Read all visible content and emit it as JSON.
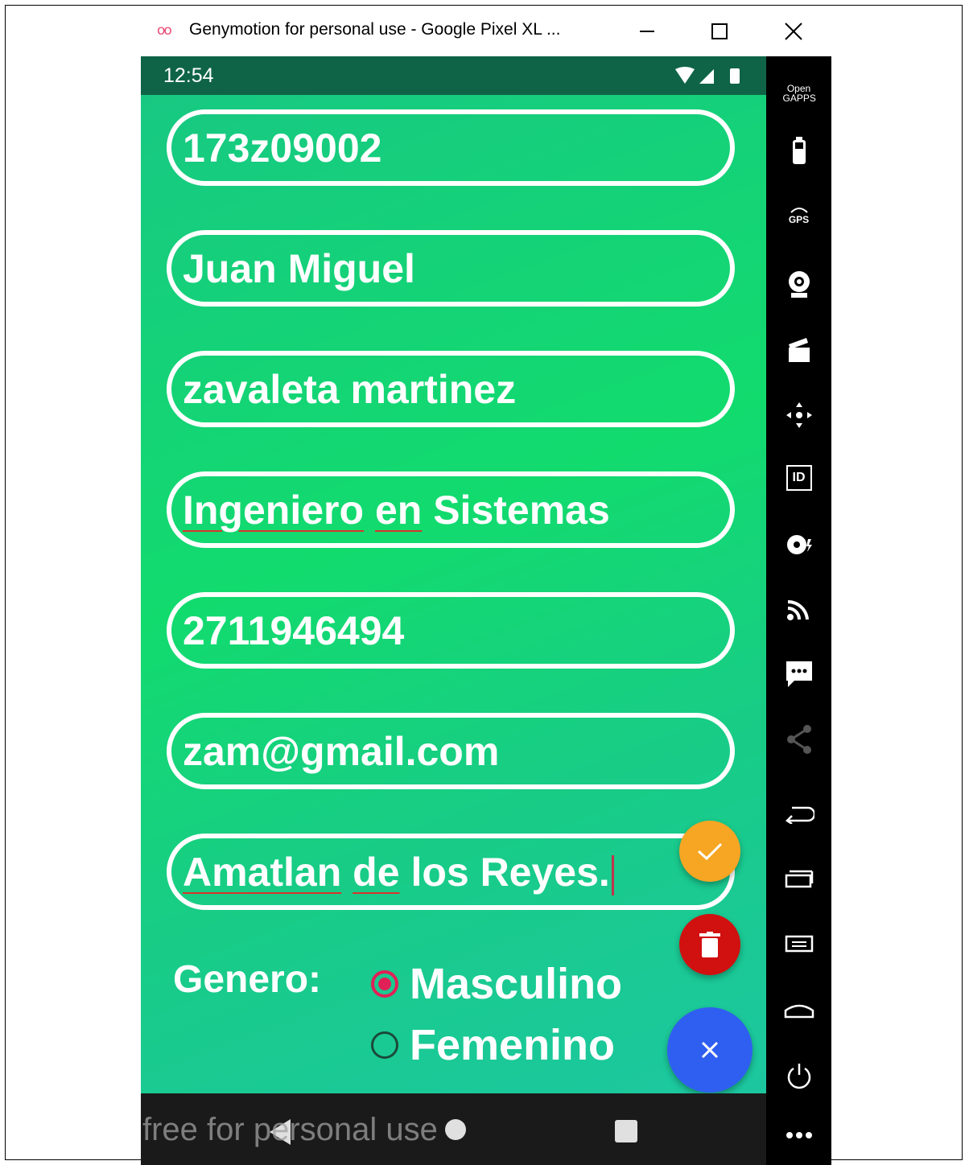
{
  "window": {
    "title": "Genymotion for personal use - Google Pixel XL ...",
    "logo": "oo",
    "controls": [
      "minimize-icon",
      "maximize-icon",
      "close-icon"
    ]
  },
  "status_bar": {
    "time": "12:54",
    "icons": [
      "wifi-icon",
      "signal-icon",
      "battery-icon"
    ]
  },
  "form": {
    "fields": [
      {
        "value": "173z09002"
      },
      {
        "value": "Juan Miguel"
      },
      {
        "value": "zavaleta martinez"
      },
      {
        "value_part1": "Ingeniero",
        "value_part2": "en",
        "value_part3": "Sistemas"
      },
      {
        "value": "2711946494"
      },
      {
        "value": "zam@gmail.com"
      },
      {
        "value_part1": "Amatlan",
        "value_part2": "de",
        "value_part3": "los Reyes."
      }
    ],
    "gender_label": "Genero:",
    "gender_options": [
      {
        "label": "Masculino",
        "selected": true
      },
      {
        "label": "Femenino",
        "selected": false
      }
    ]
  },
  "fabs": [
    {
      "icon": "check-icon",
      "color": "#f6a623"
    },
    {
      "icon": "trash-icon",
      "color": "#d11010"
    },
    {
      "icon": "close-icon",
      "color": "#2f5ff0"
    }
  ],
  "nav_bar": {
    "buttons": [
      "back-icon",
      "home-icon",
      "recents-icon"
    ],
    "watermark": "free for personal use"
  },
  "sidebar": {
    "open_gapps": "Open GAPPS",
    "gps_label": "GPS",
    "id_label": "ID",
    "icons": [
      "open-gapps-icon",
      "battery-widget-icon",
      "gps-icon",
      "camera-icon",
      "media-icon",
      "dpad-icon",
      "id-icon",
      "disk-icon",
      "cast-icon",
      "sms-icon",
      "share-icon",
      "back-icon",
      "recent-apps-icon",
      "menu-icon",
      "home-icon",
      "power-icon",
      "more-icon"
    ]
  },
  "colors": {
    "status_bar": "#0f6447",
    "screen_green": "#12db6e",
    "radio_accent": "#e02056"
  }
}
